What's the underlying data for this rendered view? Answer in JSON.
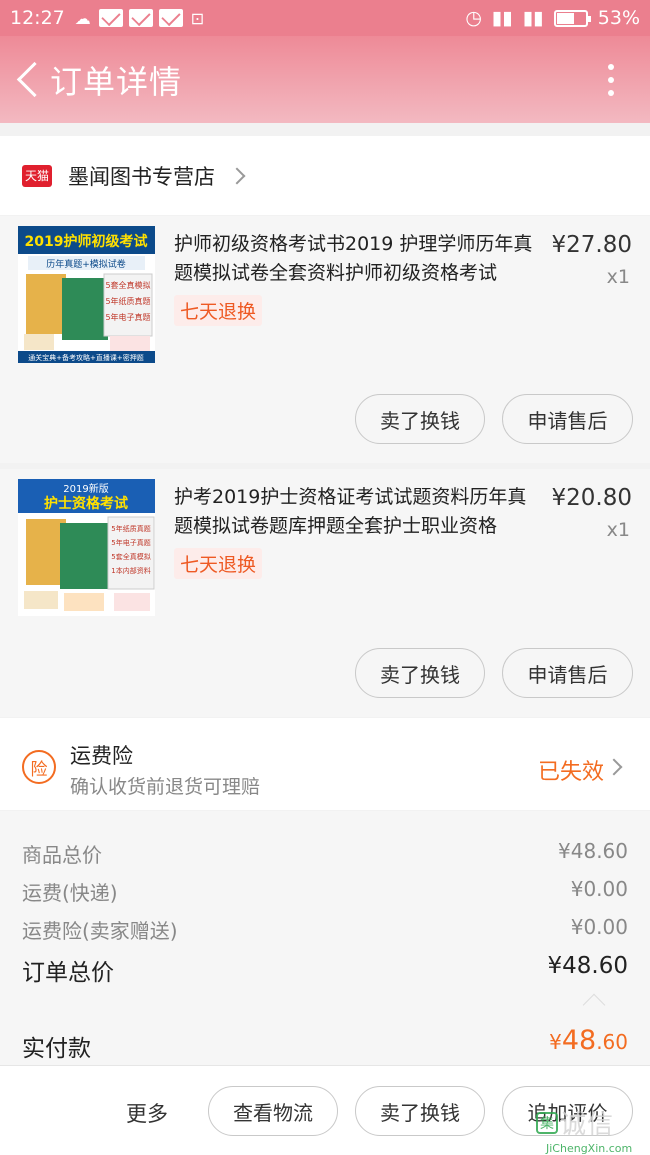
{
  "status_bar": {
    "time": "12:27",
    "battery": "53%"
  },
  "header": {
    "title": "订单详情"
  },
  "shop": {
    "name": "墨闻图书专营店",
    "badge": "天猫"
  },
  "items": [
    {
      "desc": "护师初级资格考试书2019 护理学师历年真题模拟试卷全套资料护师初级资格考试",
      "price": "¥27.80",
      "qty": "x1",
      "badge": "七天退换",
      "btn_sell": "卖了换钱",
      "btn_after": "申请售后",
      "thumb": {
        "top_text": "2019护师初级考试",
        "sub_text": "历年真题+模拟试卷",
        "tags": [
          "5套全真模拟",
          "5年纸质真题",
          "5年电子真题"
        ],
        "bottom_text": "通关宝典+备考攻略+直播课+密押题"
      }
    },
    {
      "desc": "护考2019护士资格证考试试题资料历年真题模拟试卷题库押题全套护士职业资格",
      "price": "¥20.80",
      "qty": "x1",
      "badge": "七天退换",
      "btn_sell": "卖了换钱",
      "btn_after": "申请售后",
      "thumb": {
        "top_text": "2019新版",
        "sub_text": "护士资格考试",
        "tags": [
          "5年纸质真题",
          "5年电子真题",
          "5套全真模拟",
          "1本内部资料"
        ],
        "bottom_text": ""
      }
    }
  ],
  "insurance": {
    "icon_label": "险",
    "title": "运费险",
    "subtitle": "确认收货前退货可理赔",
    "status": "已失效"
  },
  "summary": {
    "rows": [
      {
        "label": "商品总价",
        "value": "¥48.60"
      },
      {
        "label": "运费(快递)",
        "value": "¥0.00"
      },
      {
        "label": "运费险(卖家赠送)",
        "value": "¥0.00"
      }
    ],
    "total_label": "订单总价",
    "total_value": "¥48.60"
  },
  "paid": {
    "label": "实付款",
    "currency": "¥",
    "amount_int": "48",
    "amount_dec": ".60"
  },
  "bottom_bar": {
    "more": "更多",
    "logistics": "查看物流",
    "sell": "卖了换钱",
    "review": "追加评价"
  },
  "watermark": {
    "logo": "集",
    "text": "诚信",
    "sub": "JiChengXin.com"
  },
  "colors": {
    "accent": "#f36c21",
    "header": "#ee8a97",
    "tmall": "#e0202e"
  }
}
